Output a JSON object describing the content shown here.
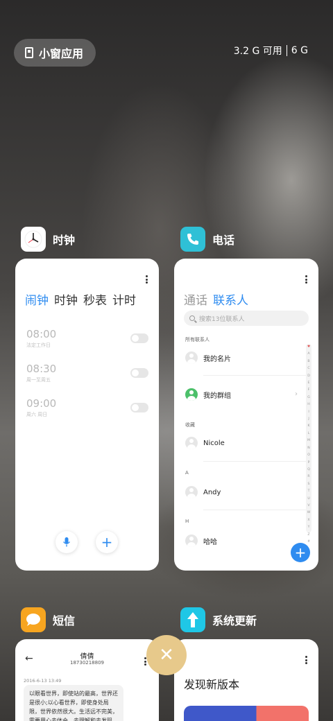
{
  "header": {
    "small_window_label": "小窗应用",
    "memory_available": "3.2 G 可用",
    "memory_total": "6 G"
  },
  "apps": {
    "clock": {
      "name": "时钟",
      "tabs": [
        "闹钟",
        "时钟",
        "秒表",
        "计时"
      ],
      "alarms": [
        {
          "time": "08:00",
          "repeat": "法定工作日"
        },
        {
          "time": "08:30",
          "repeat": "周一至周五"
        },
        {
          "time": "09:00",
          "repeat": "周六 周日"
        }
      ]
    },
    "phone": {
      "name": "电话",
      "tabs": [
        "通话",
        "联系人"
      ],
      "search_placeholder": "搜索13位联系人",
      "section_all": "所有联系人",
      "my_card": "我的名片",
      "my_groups": "我的群组",
      "section_favorites": "收藏",
      "favorite_contact": "Nicole",
      "section_a": "A",
      "contact_a": "Andy",
      "section_h": "H",
      "contact_h": "哈哈",
      "index_letters": [
        "♥",
        "A",
        "B",
        "C",
        "D",
        "E",
        "F",
        "G",
        "H",
        "I",
        "J",
        "K",
        "L",
        "M",
        "N",
        "O",
        "P",
        "Q",
        "R",
        "S",
        "T",
        "U",
        "V",
        "W",
        "X",
        "Y",
        "Z",
        "#"
      ]
    },
    "sms": {
      "name": "短信",
      "contact_name": "倩倩",
      "contact_number": "18730218809",
      "date": "2016-6-13 13:49",
      "message": "以眼看世界，即使站的最高，世界还是很小;以心看世界，即使身处局限，世界依然很大。生活远不完美，需要用心去体会，去理解和去发现。"
    },
    "update": {
      "name": "系统更新",
      "headline": "发现新版本"
    }
  },
  "colors": {
    "accent_blue": "#2f8cf0",
    "clock_icon_bg": "#ffffff",
    "phone_icon_bg": "#2fc0d6",
    "sms_icon_bg": "#f7a520",
    "update_icon_bg": "#1fc7e6",
    "close_button_bg": "#e7c98b"
  },
  "icons": {
    "clock": "clock-icon",
    "phone": "phone-icon",
    "sms": "message-icon",
    "update": "arrow-up-icon",
    "close": "close-icon"
  }
}
